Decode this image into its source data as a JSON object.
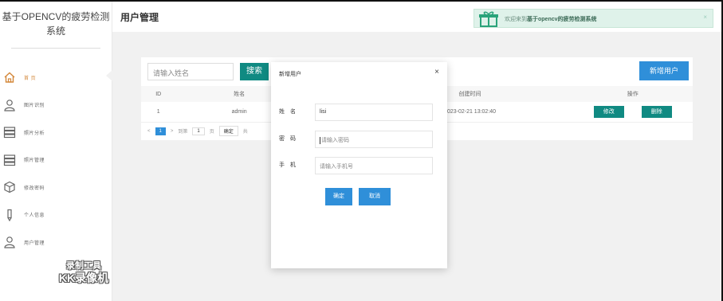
{
  "sidebar": {
    "brand_line1": "基于OPENCV的疲劳检测",
    "brand_line2": "系统",
    "items": [
      {
        "label": "首 页",
        "icon": "home-icon"
      },
      {
        "label": "图片识别",
        "icon": "user-icon"
      },
      {
        "label": "照片分析",
        "icon": "server-icon"
      },
      {
        "label": "照片管理",
        "icon": "server-icon"
      },
      {
        "label": "修改密码",
        "icon": "cube-icon"
      },
      {
        "label": "个人信息",
        "icon": "pen-icon"
      },
      {
        "label": "用户管理",
        "icon": "user-icon"
      }
    ],
    "watermark_line1": "录制工具",
    "watermark_line2": "KK录像机"
  },
  "header": {
    "title": "用户管理",
    "welcome_prefix": "欢迎来到",
    "welcome_bold": "基于opencv的疲劳检测系统",
    "close_symbol": "×"
  },
  "toolbar": {
    "search_placeholder": "请输入姓名",
    "search_label": "搜索",
    "add_label": "新增用户"
  },
  "table": {
    "columns": [
      "ID",
      "姓名",
      "创建时间",
      "操作"
    ],
    "rows": [
      {
        "id": "1",
        "name": "admin",
        "created": "2023-02-21 13:02:40",
        "edit": "修改",
        "delete": "删除"
      }
    ]
  },
  "pager": {
    "prev": "<",
    "current": "1",
    "next": ">",
    "goto": "到第",
    "page_value": "1",
    "page_unit": "页",
    "confirm": "确定",
    "total": "共"
  },
  "modal": {
    "title": "新增用户",
    "close_symbol": "×",
    "name_label": "姓名",
    "name_value": "lisi",
    "password_label": "密码",
    "password_placeholder": "请输入密码",
    "phone_label": "手机",
    "phone_placeholder": "请输入手机号",
    "ok_label": "确定",
    "cancel_label": "取消"
  },
  "colors": {
    "teal": "#108a82",
    "blue": "#2f8fd9",
    "active_nav": "#d4883b",
    "welcome_bg": "#dff2ea"
  }
}
